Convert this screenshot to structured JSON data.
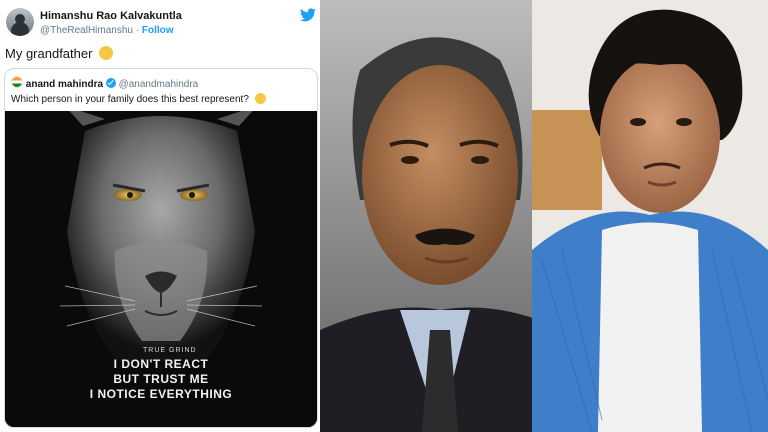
{
  "tweet": {
    "user_name": "Himanshu Rao Kalvakuntla",
    "handle": "@TheRealHimanshu",
    "separator": "·",
    "follow_label": "Follow",
    "text": "My grandfather"
  },
  "quoted_tweet": {
    "user_name": "anand mahindra",
    "handle": "@anandmahindra",
    "text": "Which person in your family does this best represent?",
    "image_brand": "TRUE GRIND",
    "image_lines": [
      "I DON'T REACT",
      "BUT TRUST ME",
      "I NOTICE EVERYTHING"
    ]
  },
  "colors": {
    "twitter_blue": "#1da1f2",
    "text_dark": "#14171a",
    "text_muted": "#657786"
  },
  "icons": [
    "twitter-bird-icon",
    "india-flag-icon",
    "verified-badge-icon",
    "grinning-sweat-emoji",
    "smiling-emoji"
  ]
}
